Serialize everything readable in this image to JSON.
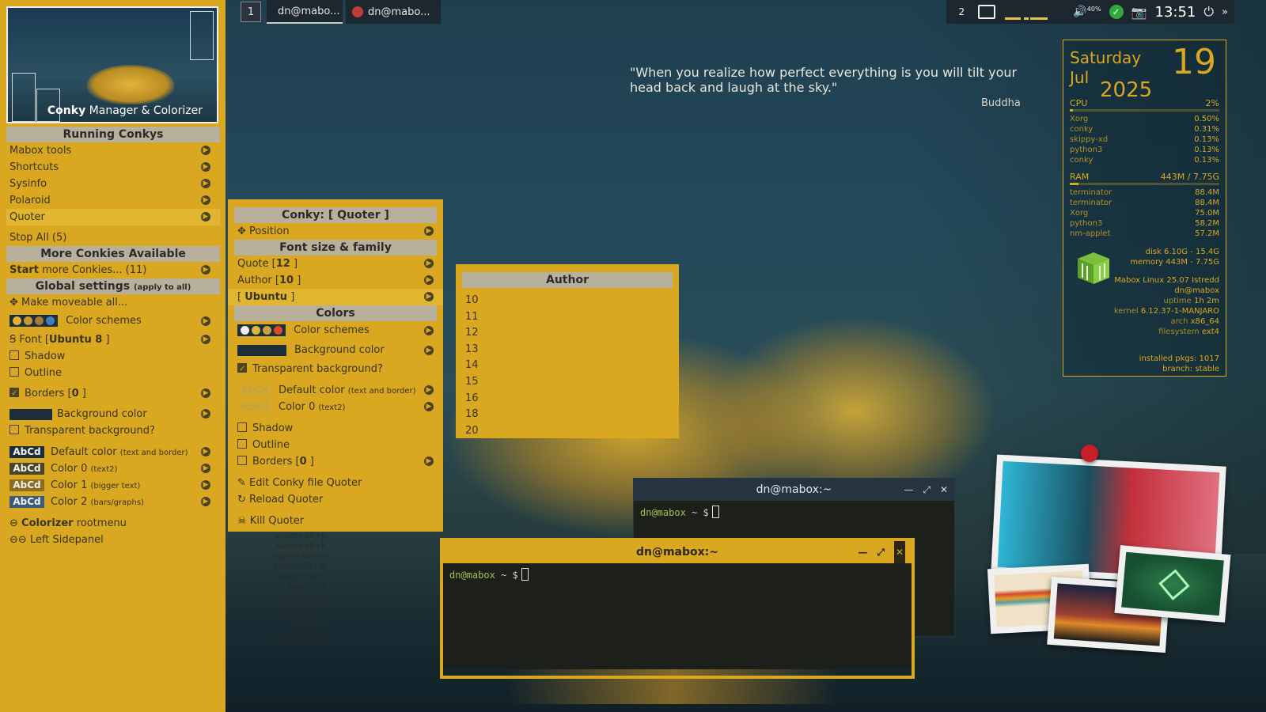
{
  "taskbar": {
    "workspace": "1",
    "tasks": [
      {
        "label": "dn@mabo..."
      },
      {
        "label": "dn@mabo..."
      }
    ],
    "tray": {
      "workspace2": "2",
      "volume": "40%",
      "clock": "13:51"
    }
  },
  "cmc": {
    "title_bold": "Conky",
    "title_rest": "Manager & Colorizer"
  },
  "left_menu": {
    "running_header": "Running Conkys",
    "running": [
      {
        "label": "Mabox tools"
      },
      {
        "label": "Shortcuts"
      },
      {
        "label": "Sysinfo"
      },
      {
        "label": "Polaroid"
      },
      {
        "label": "Quoter"
      }
    ],
    "stop_all": "Stop All (5)",
    "more_header": "More Conkies Available",
    "start_more_bold": "Start",
    "start_more_rest": "more Conkies... (11)",
    "global_header": "Global settings",
    "global_header_small": "(apply to all)",
    "make_moveable": "Make moveable all...",
    "color_schemes": "Color schemes",
    "font_label": "Font [",
    "font_value": "Ubuntu 8",
    "font_close": "]",
    "shadow": "Shadow",
    "outline": "Outline",
    "borders": "Borders [",
    "borders_value": "0",
    "borders_close": "]",
    "bg_color": "Background color",
    "transparent": "Transparent background?",
    "abcd": "AbCd",
    "default_color": "Default color",
    "default_color_small": "(text and border)",
    "color0": "Color 0",
    "color0_small": "(text2)",
    "color1": "Color 1",
    "color1_small": "(bigger text)",
    "color2": "Color 2",
    "color2_small": "(bars/graphs)",
    "colorizer_bold": "Colorizer",
    "colorizer_rest": "rootmenu",
    "left_sidepanel": "Left Sidepanel"
  },
  "shortcuts_bg": [
    {
      "key": "super+alt+p"
    },
    {
      "key": "super+alt+k"
    },
    {
      "key": "super+alt+m"
    },
    {
      "key": "super+alt+w"
    },
    {
      "key": "super+alt+l"
    },
    {
      "key": "super+F1"
    },
    {
      "key": "super+alt+o"
    },
    {
      "key": "super+alt+c"
    },
    {
      "key": "super+alt+e"
    },
    {
      "key": "super+x"
    },
    {
      "key": "super+PrtScr"
    }
  ],
  "quoter_menu": {
    "header": "Conky: [ Quoter ]",
    "position": "Position",
    "font_header": "Font size & family",
    "quote_size": "Quote [",
    "quote_size_val": "12",
    "author_size": "Author [",
    "author_size_val": "10",
    "family": "Ubuntu",
    "colors_header": "Colors",
    "color_schemes": "Color schemes",
    "bg_color": "Background color",
    "transparent": "Transparent background?",
    "abcd": "AbCd",
    "default_color": "Default color",
    "default_color_small": "(text and border)",
    "color0": "Color 0",
    "color0_small": "(text2)",
    "shadow": "Shadow",
    "outline": "Outline",
    "borders": "Borders [",
    "borders_val": "0",
    "edit": "Edit Conky file Quoter",
    "reload": "Reload Quoter",
    "kill": "Kill Quoter"
  },
  "author_menu": {
    "header": "Author",
    "sizes": [
      "10",
      "11",
      "12",
      "13",
      "14",
      "15",
      "16",
      "18",
      "20"
    ]
  },
  "quote": {
    "text": "\"When you realize how perfect everything is you will tilt your head back and laugh at the sky.\"",
    "author": "Buddha"
  },
  "sysinfo": {
    "day": "Saturday",
    "month": "Jul",
    "year": "2025",
    "date": "19",
    "cpu_label": "CPU",
    "cpu_value": "2%",
    "cpu_fraction": 0.02,
    "cpu_procs": [
      {
        "name": "Xorg",
        "val": "0.50%"
      },
      {
        "name": "conky",
        "val": "0.31%"
      },
      {
        "name": "skippy-xd",
        "val": "0.13%"
      },
      {
        "name": "python3",
        "val": "0.13%"
      },
      {
        "name": "conky",
        "val": "0.13%"
      }
    ],
    "ram_label": "RAM",
    "ram_value": "443M / 7.75G",
    "ram_fraction": 0.06,
    "ram_procs": [
      {
        "name": "terminator",
        "val": "88.4M"
      },
      {
        "name": "terminator",
        "val": "88.4M"
      },
      {
        "name": "Xorg",
        "val": "75.0M"
      },
      {
        "name": "python3",
        "val": "58.2M"
      },
      {
        "name": "nm-applet",
        "val": "57.2M"
      }
    ],
    "disk_label": "disk",
    "disk_value": "6.10G - 15.4G",
    "memory_label": "memory",
    "memory_value": "443M - 7.75G",
    "os": "Mabox Linux 25.07 Istredd",
    "user": "dn@mabox",
    "uptime_label": "uptime",
    "uptime_value": "1h 2m",
    "kernel_label": "kernel",
    "kernel_value": "6.12.37-1-MANJARO",
    "arch_label": "arch",
    "arch_value": "x86_64",
    "fs_label": "filesystem",
    "fs_value": "ext4",
    "pkgs_label": "installed pkgs:",
    "pkgs_value": "1017",
    "branch_label": "branch:",
    "branch_value": "stable"
  },
  "terminal_back": {
    "title": "dn@mabox:~",
    "user": "dn@mabox",
    "prompt": " ~ $"
  },
  "terminal_front": {
    "title": "dn@mabox:~",
    "user": "dn@mabox",
    "prompt": " ~ $"
  },
  "colors": {
    "panel": "#d9a720",
    "scheme_dots": [
      "#f0f0f0",
      "#e0b43a",
      "#c8a040",
      "#d94a2a"
    ],
    "left_dots": [
      "#e2b02c",
      "#c89a2e",
      "#a07a36",
      "#3f7fbf"
    ],
    "abcd_bg": [
      "#1c2e3a",
      "#4b4424",
      "#8c6f1d",
      "#3a5b7a"
    ]
  }
}
